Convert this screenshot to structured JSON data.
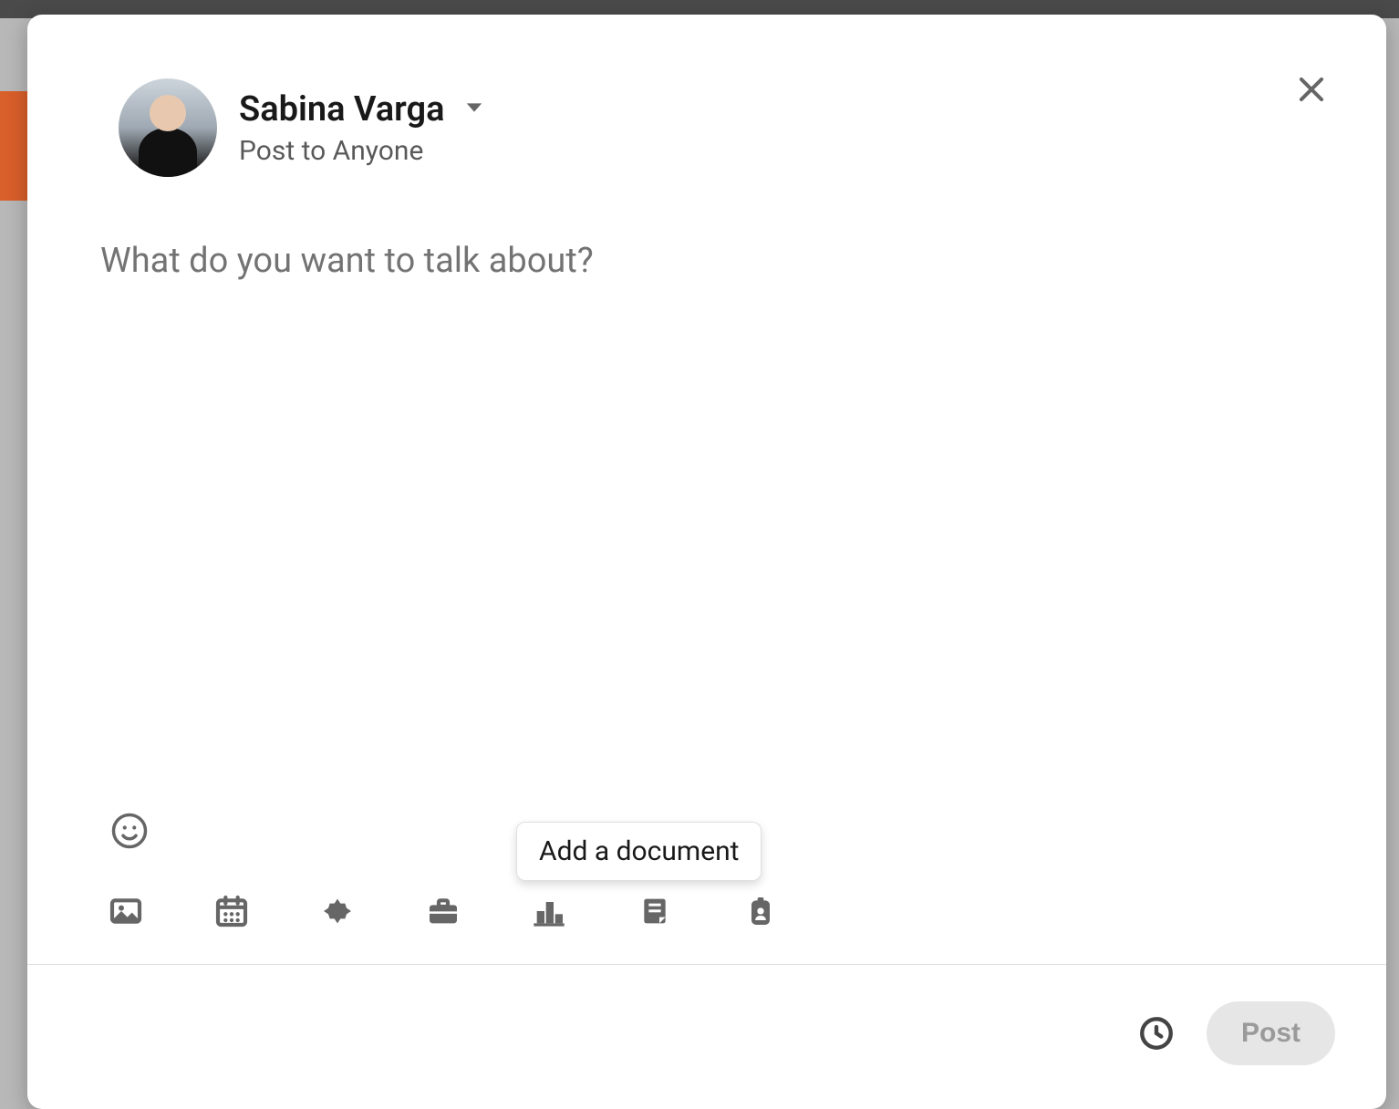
{
  "author": {
    "name": "Sabina Varga",
    "visibility": "Post to Anyone"
  },
  "editor": {
    "placeholder": "What do you want to talk about?",
    "value": ""
  },
  "tooltip": {
    "add_document": "Add a document"
  },
  "footer": {
    "post_label": "Post"
  },
  "icons": {
    "close": "close-icon",
    "caret": "caret-down-icon",
    "emoji": "emoji-icon",
    "photo": "photo-icon",
    "calendar": "calendar-icon",
    "celebrate": "celebrate-icon",
    "job": "briefcase-icon",
    "poll": "poll-icon",
    "document": "document-icon",
    "hiring": "id-badge-icon",
    "schedule": "clock-icon"
  }
}
